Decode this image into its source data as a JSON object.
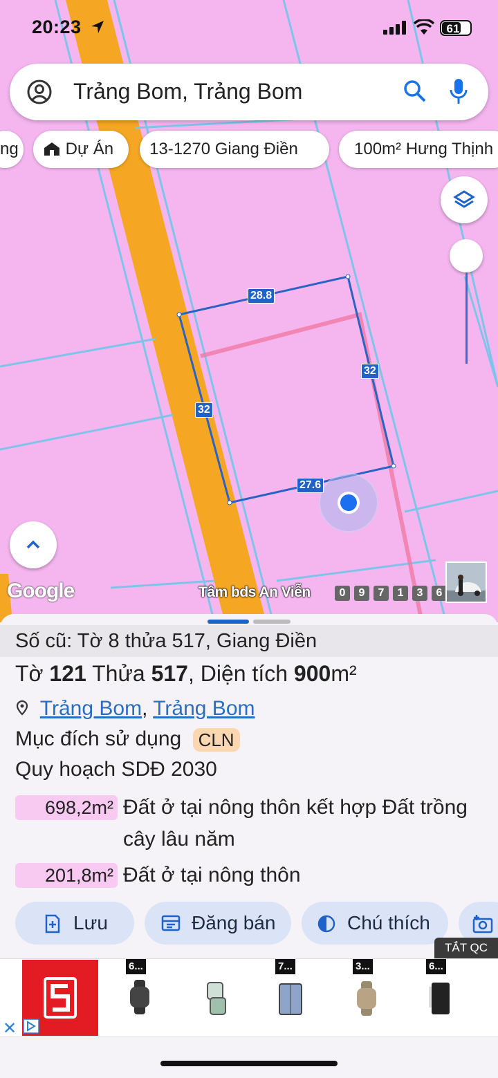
{
  "status_bar": {
    "time": "20:23",
    "battery": "61"
  },
  "search": {
    "query": "Trảng Bom, Trảng Bom"
  },
  "chips": [
    {
      "label": "ng"
    },
    {
      "label": "Dự Án",
      "icon": "house-icon"
    },
    {
      "label": "13-1270 Giang Điền"
    },
    {
      "label": "100m² Hưng Thịnh"
    }
  ],
  "map": {
    "measurements": {
      "top": "28.8",
      "left": "32",
      "right": "32",
      "bottom": "27.6"
    },
    "google_logo": "Google",
    "watermark": "Tâm bds An Viễn",
    "phone_digits": [
      "0",
      "9",
      "7",
      "1",
      "3",
      "6"
    ]
  },
  "parcel": {
    "old_ref": "Số cũ: Tờ 8 thửa 517, Giang Điền",
    "title_prefix": "Tờ",
    "sheet_no": "121",
    "plot_label": "Thửa",
    "plot_no": "517",
    "area_label": "Diện tích",
    "area_value": "900",
    "area_unit": "m²",
    "location": {
      "district": "Trảng Bom",
      "separator": ",",
      "commune": "Trảng Bom"
    },
    "purpose_label": "Mục đích sử dụng",
    "purpose_code": "CLN",
    "plan_label": "Quy hoạch SDĐ 2030",
    "zones": [
      {
        "area": "698,2m²",
        "desc": "Đất ở tại nông thôn kết hợp Đất trồng cây lâu năm"
      },
      {
        "area": "201,8m²",
        "desc": "Đất ở tại nông thôn"
      }
    ]
  },
  "actions": [
    {
      "label": "Lưu",
      "icon": "bookmark-add-icon"
    },
    {
      "label": "Đăng bán",
      "icon": "listing-icon"
    },
    {
      "label": "Chú thích",
      "icon": "contrast-icon"
    }
  ],
  "ad": {
    "hide_label": "TẮT QC",
    "tags": [
      "6...",
      "7...",
      "3...",
      "6..."
    ]
  },
  "colors": {
    "land_pink": "#f5b6f0",
    "road_orange": "#f5a623",
    "accent_blue": "#1f62c9"
  }
}
